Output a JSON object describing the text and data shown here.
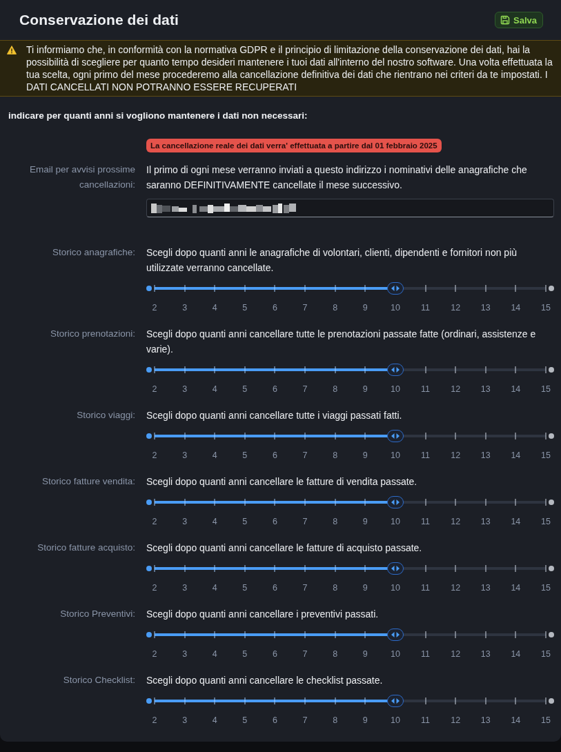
{
  "header": {
    "title": "Conservazione dei dati",
    "save_button": "Salva"
  },
  "notice": {
    "text": "Ti informiamo che, in conformità con la normativa GDPR e il principio di limitazione della conservazione dei dati, hai la possibilità di scegliere per quanto tempo desideri mantenere i tuoi dati all'interno del nostro software. Una volta effettuata la tua scelta, ogni primo del mese procederemo alla cancellazione definitiva dei dati che rientrano nei criteri da te impostati. I DATI CANCELLATI NON POTRANNO ESSERE RECUPERATI"
  },
  "intro": "indicare per quanti anni si vogliono mantenere i dati non necessari:",
  "deletion_badge": "La cancellazione reale dei dati verra' effettuata a partire dal 01 febbraio 2025",
  "email": {
    "label": "Email per avvisi prossime cancellazioni:",
    "description": "Il primo di ogni mese verranno inviati a questo indirizzo i nominativi delle anagrafiche che saranno DEFINITIVAMENTE cancellate il mese successivo.",
    "value_redacted": true
  },
  "settings": [
    {
      "label": "Storico anagrafiche:",
      "description": "Scegli dopo quanti anni le anagrafiche di volontari, clienti, dipendenti e fornitori non più utilizzate verranno cancellate.",
      "slider": {
        "level": 0.615,
        "ticks": [
          "2",
          "3",
          "4",
          "5",
          "6",
          "7",
          "8",
          "9",
          "10",
          "11",
          "12",
          "13",
          "14",
          "15"
        ]
      }
    },
    {
      "label": "Storico prenotazioni:",
      "description": "Scegli dopo quanti anni cancellare tutte le prenotazioni passate fatte (ordinari, assistenze e varie).",
      "slider": {
        "level": 0.615,
        "ticks": [
          "2",
          "3",
          "4",
          "5",
          "6",
          "7",
          "8",
          "9",
          "10",
          "11",
          "12",
          "13",
          "14",
          "15"
        ]
      }
    },
    {
      "label": "Storico viaggi:",
      "description": "Scegli dopo quanti anni cancellare tutte i viaggi passati fatti.",
      "slider": {
        "level": 0.615,
        "ticks": [
          "2",
          "3",
          "4",
          "5",
          "6",
          "7",
          "8",
          "9",
          "10",
          "11",
          "12",
          "13",
          "14",
          "15"
        ]
      }
    },
    {
      "label": "Storico fatture vendita:",
      "description": "Scegli dopo quanti anni cancellare le fatture di vendita passate.",
      "slider": {
        "level": 0.615,
        "ticks": [
          "2",
          "3",
          "4",
          "5",
          "6",
          "7",
          "8",
          "9",
          "10",
          "11",
          "12",
          "13",
          "14",
          "15"
        ]
      }
    },
    {
      "label": "Storico fatture acquisto:",
      "description": "Scegli dopo quanti anni cancellare le fatture di acquisto passate.",
      "slider": {
        "level": 0.615,
        "ticks": [
          "2",
          "3",
          "4",
          "5",
          "6",
          "7",
          "8",
          "9",
          "10",
          "11",
          "12",
          "13",
          "14",
          "15"
        ]
      }
    },
    {
      "label": "Storico Preventivi:",
      "description": "Scegli dopo quanti anni cancellare i preventivi passati.",
      "slider": {
        "level": 0.615,
        "ticks": [
          "2",
          "3",
          "4",
          "5",
          "6",
          "7",
          "8",
          "9",
          "10",
          "11",
          "12",
          "13",
          "14",
          "15"
        ]
      }
    },
    {
      "label": "Storico Checklist:",
      "description": "Scegli dopo quanti anni cancellare le checklist passate.",
      "slider": {
        "level": 0.615,
        "ticks": [
          "2",
          "3",
          "4",
          "5",
          "6",
          "7",
          "8",
          "9",
          "10",
          "11",
          "12",
          "13",
          "14",
          "15"
        ]
      }
    }
  ]
}
